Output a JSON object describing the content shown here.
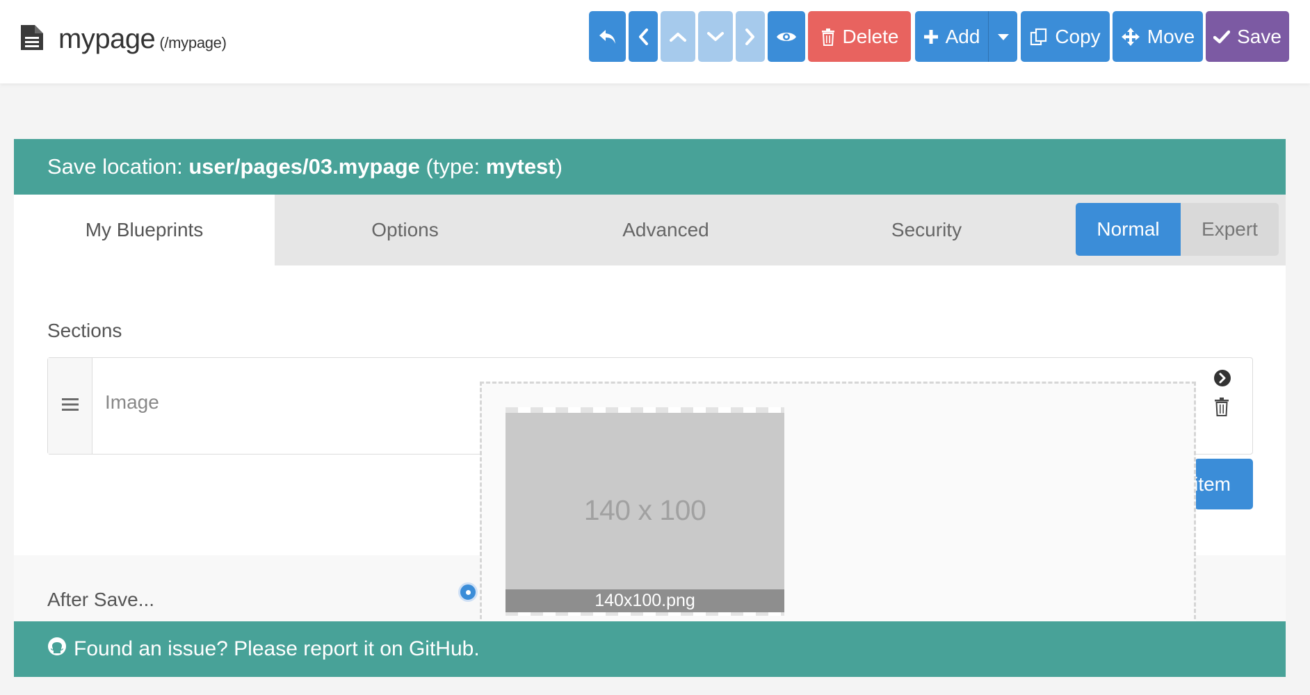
{
  "header": {
    "page_name": "mypage",
    "page_route": "(/mypage)",
    "icon": "file-document-icon"
  },
  "toolbar": {
    "back_icon": "reply-icon",
    "prev_icon": "chevron-left-icon",
    "up_icon": "chevron-up-icon",
    "down_icon": "chevron-down-icon",
    "next_icon": "chevron-right-icon",
    "preview_icon": "eye-icon",
    "delete_label": "Delete",
    "add_label": "Add",
    "copy_label": "Copy",
    "move_label": "Move",
    "save_label": "Save",
    "colors": {
      "primary": "#3b8dd8",
      "disabled": "#a6caec",
      "danger": "#e8635f",
      "save": "#7c5aa3"
    }
  },
  "location": {
    "prefix": "Save location: ",
    "path": "user/pages/03.mypage",
    "type_prefix": " (type: ",
    "type": "mytest",
    "type_suffix": ")",
    "color": "#48a298"
  },
  "tabs": [
    {
      "label": "My Blueprints",
      "active": true
    },
    {
      "label": "Options",
      "active": false
    },
    {
      "label": "Advanced",
      "active": false
    },
    {
      "label": "Security",
      "active": false
    }
  ],
  "mode": {
    "normal_label": "Normal",
    "expert_label": "Expert",
    "selected": "Normal"
  },
  "sections": {
    "label": "Sections",
    "items": [
      {
        "label": "Image"
      }
    ],
    "add_item_label": "Add item"
  },
  "preview": {
    "dimensions_text": "140 x 100",
    "filename": "140x100.png"
  },
  "after_save": {
    "label": "After Save..."
  },
  "footer": {
    "text": "Found an issue? Please report it on GitHub.",
    "icon": "github-icon"
  }
}
